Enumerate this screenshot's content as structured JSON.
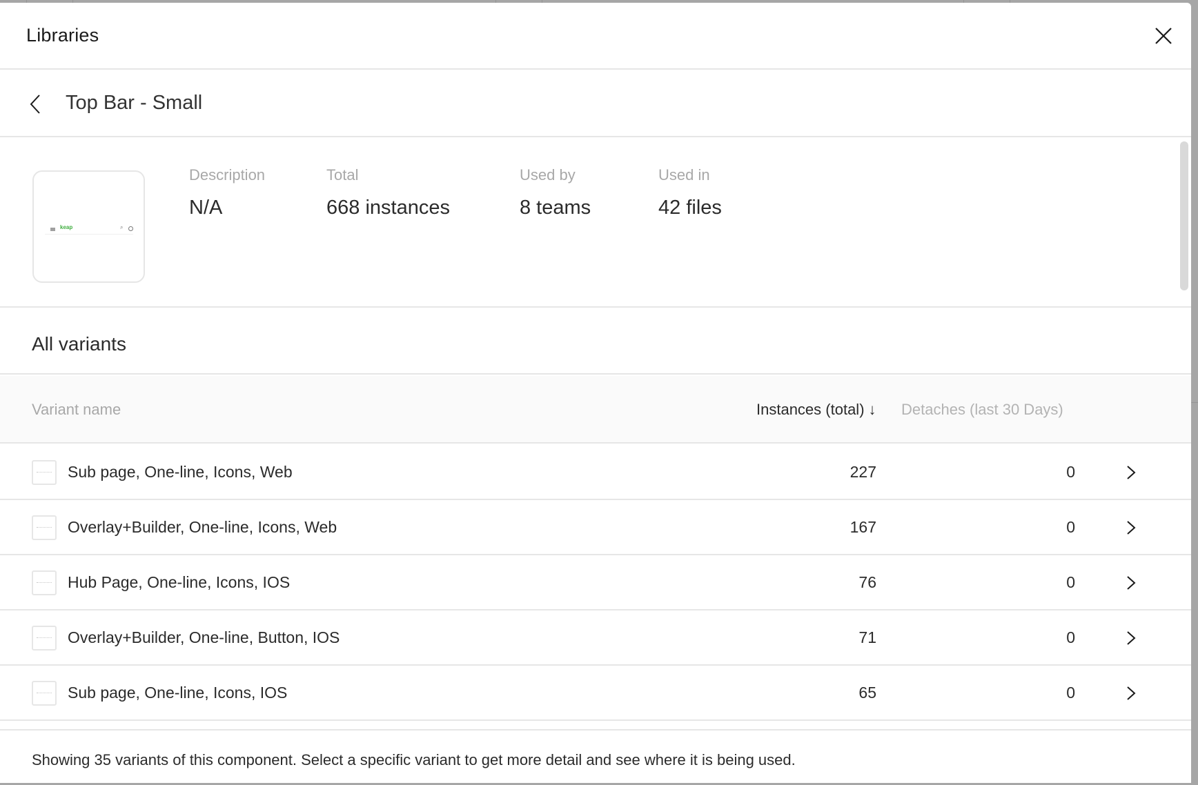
{
  "modal": {
    "title": "Libraries",
    "close_icon": "close-icon"
  },
  "breadcrumb": {
    "back_icon": "chevron-left-icon",
    "component_name": "Top Bar - Small"
  },
  "summary": {
    "thumbnail": {
      "logo_text": "keap",
      "icons": [
        "menu-icon",
        "search-icon",
        "help-icon"
      ],
      "brand_color": "#3fae3f"
    },
    "stats": [
      {
        "label": "Description",
        "value": "N/A"
      },
      {
        "label": "Total",
        "value": "668 instances"
      },
      {
        "label": "Used by",
        "value": "8 teams"
      },
      {
        "label": "Used in",
        "value": "42 files"
      }
    ]
  },
  "variants": {
    "heading": "All variants",
    "columns": {
      "name": "Variant name",
      "instances": "Instances (total)",
      "instances_sort_icon": "↓",
      "detaches": "Detaches (last 30 Days)"
    },
    "rows": [
      {
        "name": "Sub page, One-line, Icons, Web",
        "instances": "227",
        "detaches": "0"
      },
      {
        "name": "Overlay+Builder, One-line, Icons, Web",
        "instances": "167",
        "detaches": "0"
      },
      {
        "name": "Hub Page, One-line, Icons, IOS",
        "instances": "76",
        "detaches": "0"
      },
      {
        "name": "Overlay+Builder, One-line, Button, IOS",
        "instances": "71",
        "detaches": "0"
      },
      {
        "name": "Sub page, One-line, Icons, IOS",
        "instances": "65",
        "detaches": "0"
      }
    ]
  },
  "footer": {
    "note": "Showing 35 variants of this component. Select a specific variant to get more detail and see where it is being used."
  }
}
